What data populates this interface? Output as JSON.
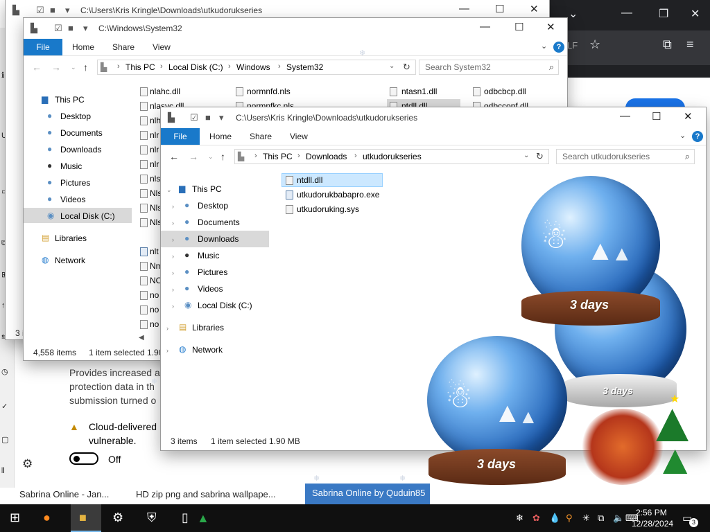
{
  "background": {
    "defender_text": "Provides increased a protection data in th submission turned o",
    "warning_text": "Cloud-delivered vulnerable.",
    "toggle_label": "Off",
    "bottom_tabs": [
      "Sabrina Online - Jan...",
      "HD zip png and sabrina wallpape...",
      "Sabrina Online by Quduin85"
    ],
    "browser_partial_text": "LF"
  },
  "window_back": {
    "title": "C:\\Users\\Kris Kringle\\Downloads\\utkudorukseries",
    "status_count": "3 i"
  },
  "window_system32": {
    "title": "C:\\Windows\\System32",
    "tabs": [
      "File",
      "Home",
      "Share",
      "View"
    ],
    "breadcrumb": [
      "This PC",
      "Local Disk (C:)",
      "Windows",
      "System32"
    ],
    "search_placeholder": "Search System32",
    "nav": [
      "This PC",
      "Desktop",
      "Documents",
      "Downloads",
      "Music",
      "Pictures",
      "Videos",
      "Local Disk (C:)",
      "Libraries",
      "Network"
    ],
    "files_col1": [
      "nlahc.dll",
      "nlasvc.dll",
      "nlh",
      "nlr",
      "nlr",
      "nlr",
      "nls",
      "Nls",
      "Nls",
      "Nls",
      "nlt",
      "Nm",
      "NO",
      "no",
      "no",
      "no"
    ],
    "files_col2": [
      "normnfd.nls",
      "normnfkc.nls"
    ],
    "files_col3": [
      "ntasn1.dll",
      "ntdll.dll"
    ],
    "files_col4": [
      "odbcbcp.dll",
      "odbcconf.dll"
    ],
    "status_items": "4,558 items",
    "status_selected": "1 item selected  1.90"
  },
  "window_front": {
    "title": "C:\\Users\\Kris Kringle\\Downloads\\utkudorukseries",
    "tabs": [
      "File",
      "Home",
      "Share",
      "View"
    ],
    "breadcrumb": [
      "This PC",
      "Downloads",
      "utkudorukseries"
    ],
    "search_placeholder": "Search utkudorukseries",
    "nav": [
      "This PC",
      "Desktop",
      "Documents",
      "Downloads",
      "Music",
      "Pictures",
      "Videos",
      "Local Disk (C:)",
      "Libraries",
      "Network"
    ],
    "files": [
      "ntdll.dll",
      "utkudorukbabapro.exe",
      "utkudoruking.sys"
    ],
    "status_items": "3 items",
    "status_selected": "1 item selected  1.90 MB"
  },
  "globes": {
    "label": "3 days"
  },
  "taskbar": {
    "time": "2:56 PM",
    "date": "12/28/2024",
    "notification_count": "3",
    "apps": [
      "start-icon",
      "firefox-icon",
      "file-explorer-icon",
      "settings-icon",
      "defender-icon",
      "app-icon"
    ],
    "tray": [
      "snowflake-icon",
      "gift-icon",
      "droplet-icon",
      "search-icon",
      "sparkle-icon",
      "network-icon",
      "speaker-icon",
      "language-icon"
    ]
  },
  "colors": {
    "file_tab": "#1979ca",
    "taskbar": "#101010",
    "selection": "#cce8ff",
    "nav_selection": "#d9d9d9"
  }
}
